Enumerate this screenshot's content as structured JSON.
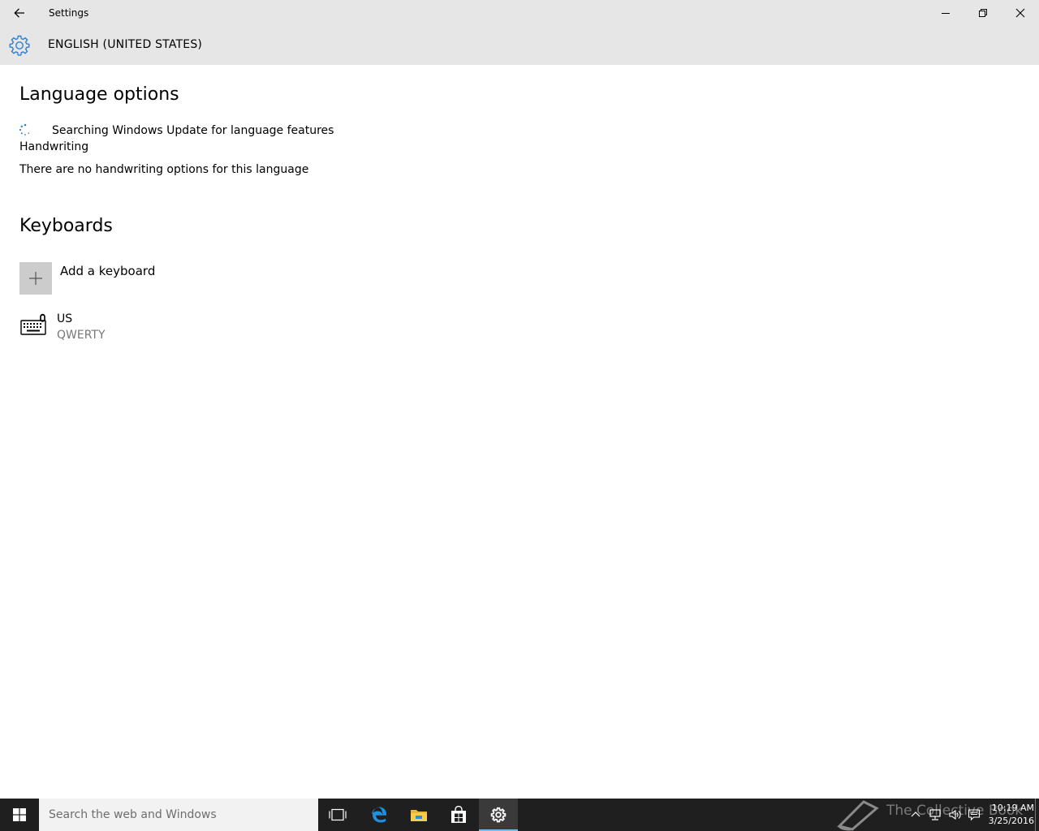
{
  "window": {
    "title": "Settings"
  },
  "header": {
    "title": "ENGLISH (UNITED STATES)",
    "accent_color": "#2d7fd3"
  },
  "language_options": {
    "heading": "Language options",
    "status": "Searching Windows Update for language features",
    "handwriting_label": "Handwriting",
    "handwriting_message": "There are no handwriting options for this language"
  },
  "keyboards": {
    "heading": "Keyboards",
    "add_label": "Add a keyboard",
    "items": [
      {
        "name": "US",
        "layout": "QWERTY"
      }
    ]
  },
  "taskbar": {
    "search_placeholder": "Search the web and Windows",
    "watermark": "The Collective Book",
    "time": "10:19 AM",
    "date": "3/25/2016",
    "icons": [
      "start-icon",
      "task-view-icon",
      "edge-icon",
      "file-explorer-icon",
      "store-icon",
      "settings-icon"
    ],
    "active_color": "#76b9ed"
  }
}
